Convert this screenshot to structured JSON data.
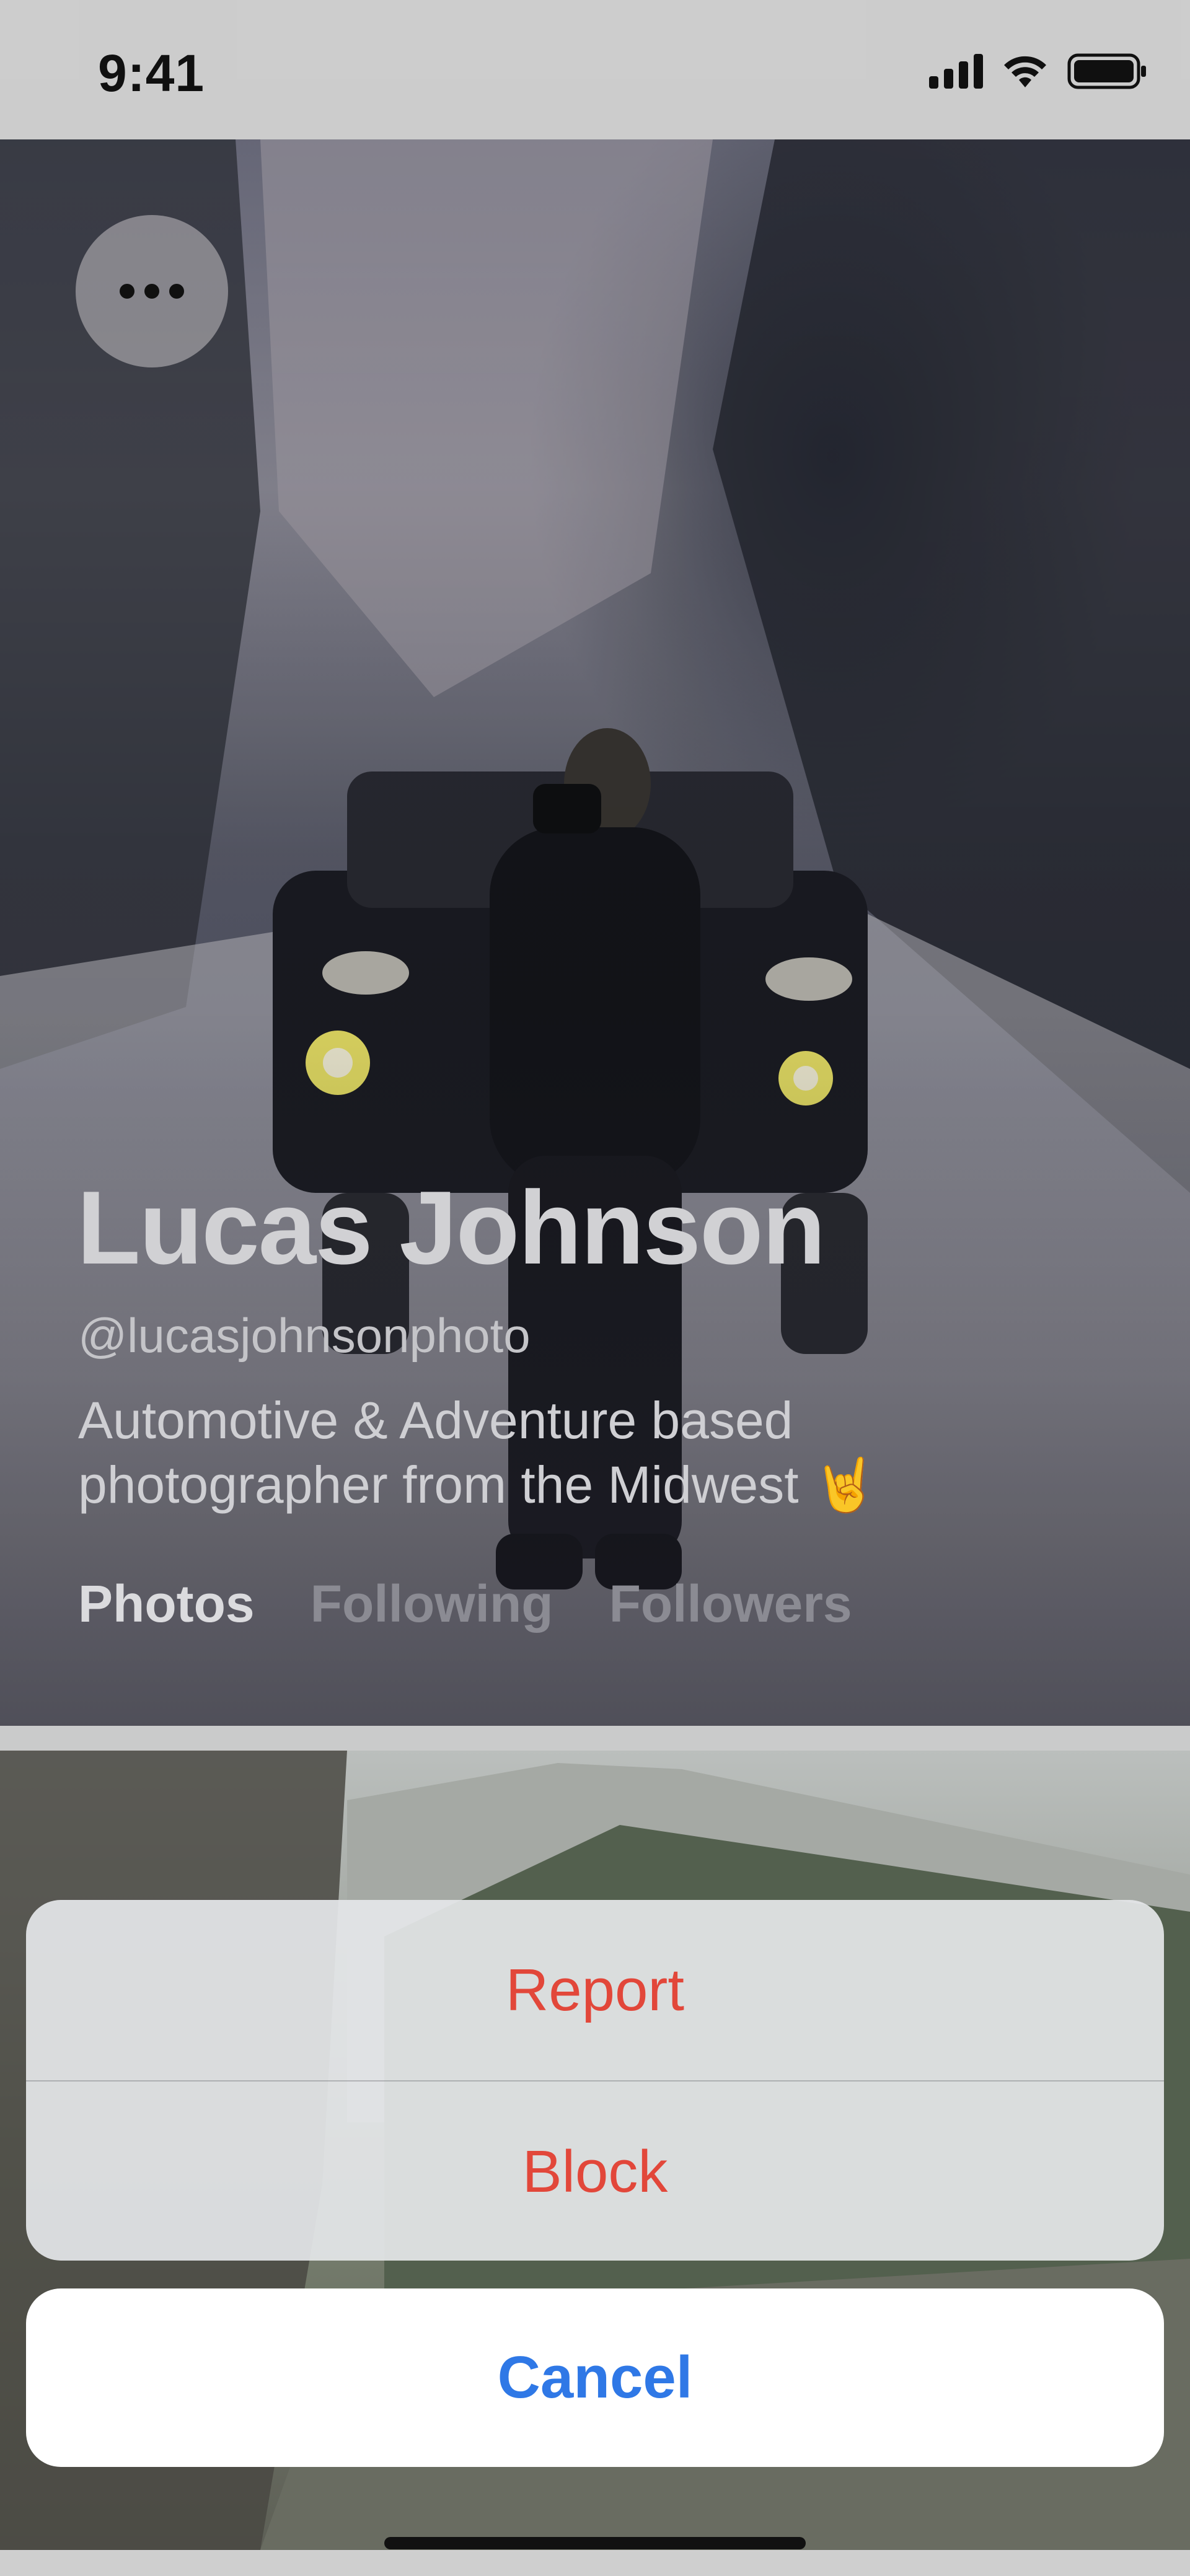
{
  "status_bar": {
    "time": "9:41",
    "icons": [
      "cellular-signal-icon",
      "wifi-icon",
      "battery-icon"
    ]
  },
  "profile": {
    "name": "Lucas Johnson",
    "handle": "@lucasjohnsonphoto",
    "bio": "Automotive & Adventure based photographer from the Midwest 🤘",
    "more_icon": "ellipsis-icon"
  },
  "tabs": [
    {
      "label": "Photos",
      "active": true
    },
    {
      "label": "Following",
      "active": false
    },
    {
      "label": "Followers",
      "active": false
    }
  ],
  "action_sheet": {
    "items": [
      {
        "label": "Report"
      },
      {
        "label": "Block"
      }
    ],
    "cancel_label": "Cancel"
  },
  "colors": {
    "destructive": "#e2473a",
    "cancel": "#2f78e6"
  }
}
